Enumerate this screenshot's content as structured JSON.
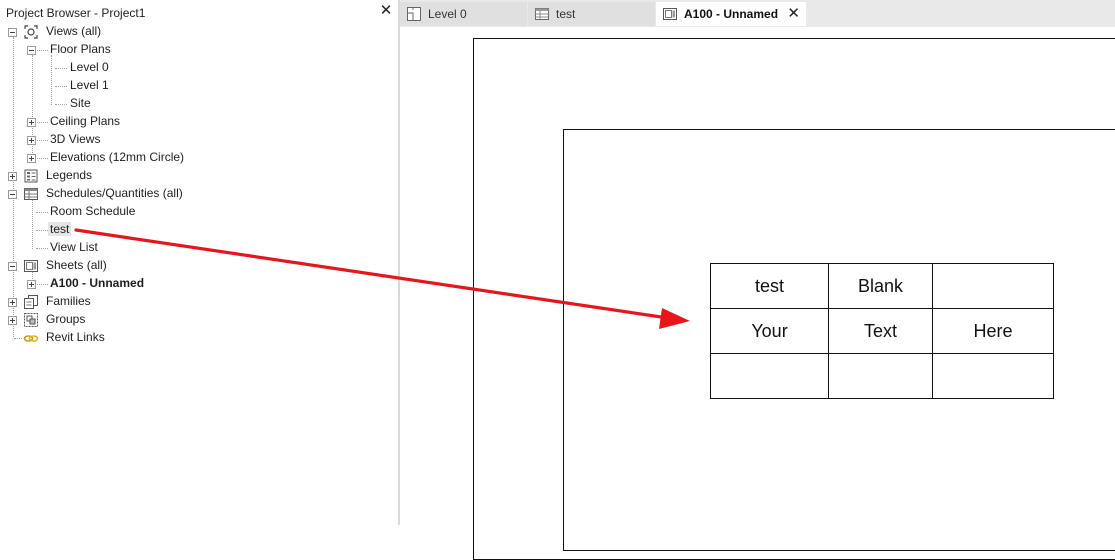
{
  "browser": {
    "title": "Project Browser - Project1",
    "close_icon": "close-icon",
    "items": [
      {
        "label": "Views (all)",
        "icon": "views-icon"
      },
      {
        "label": "Floor Plans"
      },
      {
        "label": "Level 0"
      },
      {
        "label": "Level 1"
      },
      {
        "label": "Site"
      },
      {
        "label": "Ceiling Plans"
      },
      {
        "label": "3D Views"
      },
      {
        "label": "Elevations (12mm Circle)"
      },
      {
        "label": "Legends",
        "icon": "legends-icon"
      },
      {
        "label": "Schedules/Quantities (all)",
        "icon": "schedule-icon"
      },
      {
        "label": "Room Schedule"
      },
      {
        "label": "test",
        "selected": true
      },
      {
        "label": "View List"
      },
      {
        "label": "Sheets (all)",
        "icon": "sheets-icon"
      },
      {
        "label": "A100 - Unnamed",
        "bold": true
      },
      {
        "label": "Families",
        "icon": "families-icon"
      },
      {
        "label": "Groups",
        "icon": "groups-icon"
      },
      {
        "label": "Revit Links",
        "icon": "revit-links-icon"
      }
    ]
  },
  "tabs": [
    {
      "label": "Level 0",
      "icon": "floor-plan-icon",
      "active": false
    },
    {
      "label": "test",
      "icon": "schedule-icon",
      "active": false
    },
    {
      "label": "A100 - Unnamed",
      "icon": "sheet-icon",
      "active": true
    }
  ],
  "schedule": {
    "rows": [
      [
        "test",
        "Blank",
        ""
      ],
      [
        "Your",
        "Text",
        "Here"
      ],
      [
        "",
        "",
        ""
      ]
    ]
  },
  "colors": {
    "arrow": "#e8161b",
    "selection": "#e5e5e5",
    "tab_active": "#ffffff",
    "tab_inactive": "#e0e0e0"
  }
}
